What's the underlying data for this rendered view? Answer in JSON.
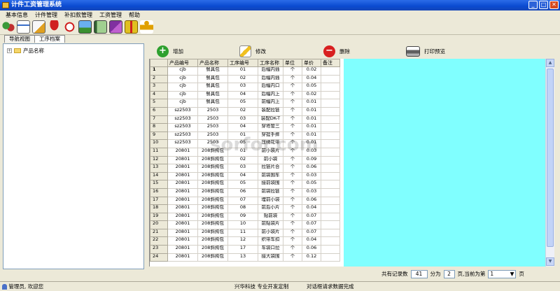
{
  "window": {
    "title": "计件工资管理系统"
  },
  "menu": [
    "基本信息",
    "计件管理",
    "补扣款管理",
    "工资管理",
    "帮助"
  ],
  "toolbar_icons": [
    "users-icon",
    "document-icon",
    "edit-document-icon",
    "umbrella-icon",
    "alarm-clock-icon",
    "picture-icon",
    "notebook-icon",
    "book-icon",
    "gift-icon",
    "runner-icon"
  ],
  "tabs": [
    "导航视图",
    "工序档案"
  ],
  "tree": {
    "root": "产品名称"
  },
  "actions": {
    "add": "增加",
    "edit": "修改",
    "delete": "删除",
    "print": "打印预览"
  },
  "columns": [
    "产品编号",
    "产品名称",
    "工序编号",
    "工序名称",
    "单位",
    "单价",
    "备注"
  ],
  "rows": [
    [
      "1",
      "cjb",
      "餐具包",
      "01",
      "后幅内插",
      "个",
      "0.02",
      ""
    ],
    [
      "2",
      "cjb",
      "餐具包",
      "02",
      "后幅内插",
      "个",
      "0.04",
      ""
    ],
    [
      "3",
      "cjb",
      "餐具包",
      "03",
      "后幅内口",
      "个",
      "0.05",
      ""
    ],
    [
      "4",
      "cjb",
      "餐具包",
      "04",
      "后幅内上",
      "个",
      "0.02",
      ""
    ],
    [
      "5",
      "cjb",
      "餐具包",
      "05",
      "前幅内上",
      "个",
      "0.01",
      ""
    ],
    [
      "6",
      "sz2503",
      "2503",
      "02",
      "装配拉链",
      "个",
      "0.01",
      ""
    ],
    [
      "7",
      "sz2503",
      "2503",
      "03",
      "装配DK-T",
      "个",
      "0.01",
      ""
    ],
    [
      "8",
      "sz2503",
      "2503",
      "04",
      "穿塔管三",
      "个",
      "0.01",
      ""
    ],
    [
      "9",
      "sz2503",
      "2503",
      "01",
      "穿提手摔",
      "个",
      "0.01",
      ""
    ],
    [
      "10",
      "sz2503",
      "2503",
      "05",
      "压绣花带",
      "个",
      "0.01",
      ""
    ],
    [
      "11",
      "20801",
      "208斜挎包",
      "01",
      "前小袋片",
      "个",
      "0.03",
      ""
    ],
    [
      "12",
      "20801",
      "208斜挎包",
      "02",
      "前小袋",
      "个",
      "0.09",
      ""
    ],
    [
      "13",
      "20801",
      "208斜挎包",
      "03",
      "拉链片合",
      "个",
      "0.06",
      ""
    ],
    [
      "14",
      "20801",
      "208斜挎包",
      "04",
      "前袋围车",
      "个",
      "0.03",
      ""
    ],
    [
      "15",
      "20801",
      "208斜挎包",
      "05",
      "接前袋围",
      "个",
      "0.05",
      ""
    ],
    [
      "16",
      "20801",
      "208斜挎包",
      "06",
      "前袋拉链",
      "个",
      "0.03",
      ""
    ],
    [
      "17",
      "20801",
      "208斜挎包",
      "07",
      "埋前小袋",
      "个",
      "0.06",
      ""
    ],
    [
      "18",
      "20801",
      "208斜挎包",
      "08",
      "前后小片",
      "个",
      "0.04",
      ""
    ],
    [
      "19",
      "20801",
      "208斜挎包",
      "09",
      "贴前袋",
      "个",
      "0.07",
      ""
    ],
    [
      "20",
      "20801",
      "208斜挎包",
      "10",
      "前贴袋片",
      "个",
      "0.07",
      ""
    ],
    [
      "21",
      "20801",
      "208斜挎包",
      "11",
      "前小袋片",
      "个",
      "0.07",
      ""
    ],
    [
      "22",
      "20801",
      "208斜挎包",
      "12",
      "织带车扣",
      "个",
      "0.04",
      ""
    ],
    [
      "23",
      "20801",
      "208斜挎包",
      "17",
      "车袋口拉",
      "个",
      "0.06",
      ""
    ],
    [
      "24",
      "20801",
      "208斜挎包",
      "13",
      "接大袋围",
      "个",
      "0.12",
      ""
    ]
  ],
  "pager": {
    "total_label": "共有记录数",
    "total": "41",
    "split_label": "分为",
    "pages": "2",
    "current_label": "页,当前为第",
    "current": "1",
    "suffix": "页"
  },
  "status": {
    "user": "管理员, 欢迎您",
    "company": "兴华科技 专业开发定制",
    "message": "对话框请求数据完成"
  },
  "watermark": "sorfor.com",
  "colors": {
    "grid_background": "#80ffff",
    "title_bar": "#0a4ad0"
  }
}
